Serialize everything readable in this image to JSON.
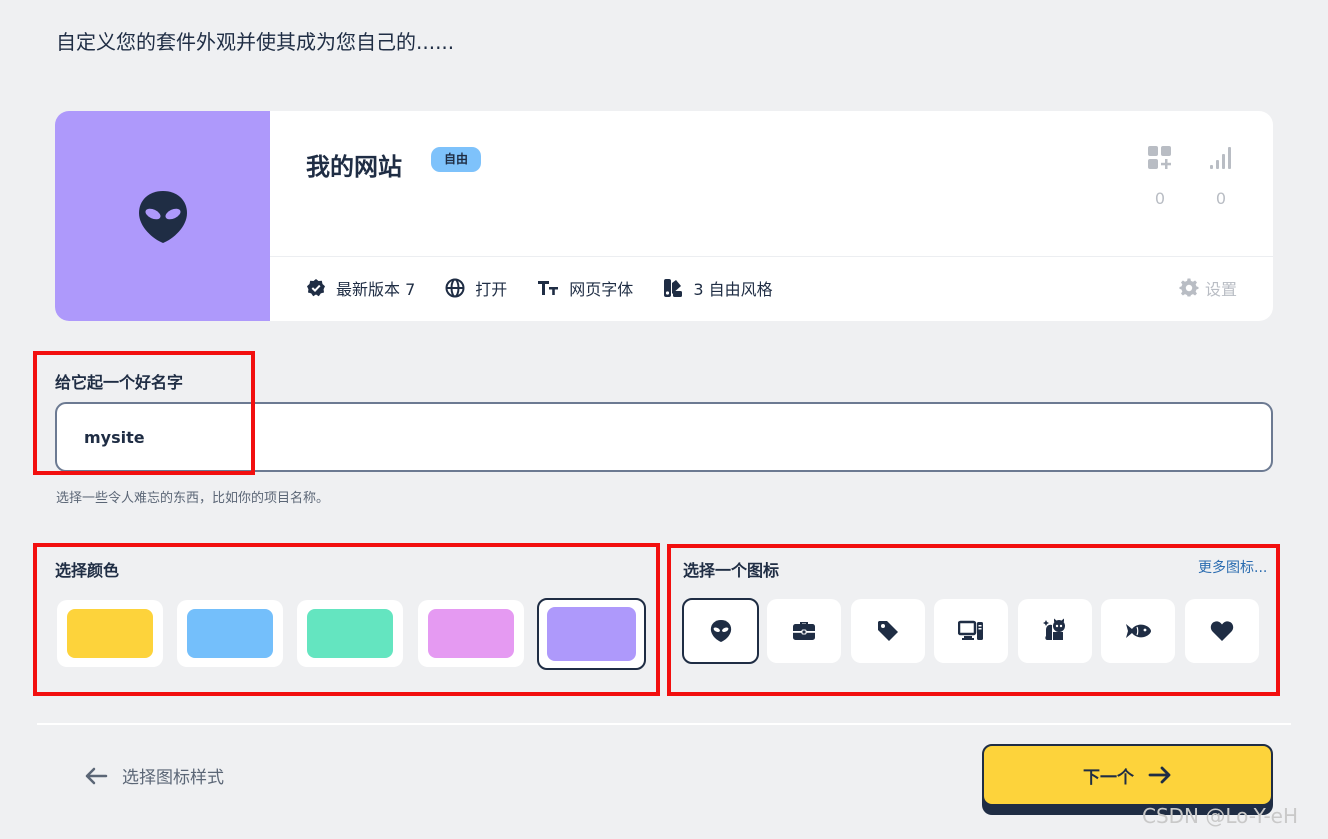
{
  "intro": "自定义您的套件外观并使其成为您自己的......",
  "card": {
    "title": "我的网站",
    "badge": "自由",
    "thumb_color": "#ae99fb",
    "stats": [
      {
        "icon": "add-widget-icon",
        "value": "0"
      },
      {
        "icon": "signal-bars-icon",
        "value": "0"
      }
    ],
    "meta": [
      {
        "icon": "verified-badge-icon",
        "label": "最新版本 7"
      },
      {
        "icon": "globe-icon",
        "label": "打开"
      },
      {
        "icon": "font-icon",
        "label": "网页字体"
      },
      {
        "icon": "style-swatch-icon",
        "label": "3 自由风格"
      }
    ],
    "settings_label": "设置"
  },
  "name_field": {
    "label": "给它起一个好名字",
    "value": "mysite",
    "hint": "选择一些令人难忘的东西，比如你的项目名称。"
  },
  "colors": {
    "label": "选择颜色",
    "options": [
      "#fdd33b",
      "#74bffb",
      "#64e5c0",
      "#e59af2",
      "#ae99fb"
    ],
    "selected": "#ae99fb"
  },
  "icons": {
    "label": "选择一个图标",
    "more_label": "更多图标...",
    "options": [
      "alien-icon",
      "briefcase-icon",
      "tag-icon",
      "devices-icon",
      "cat-icon",
      "fish-icon",
      "heart-icon"
    ],
    "selected": "alien-icon"
  },
  "footer": {
    "back_label": "选择图标样式",
    "next_label": "下一个"
  },
  "watermark": "CSDN @Lo-Y-eH"
}
